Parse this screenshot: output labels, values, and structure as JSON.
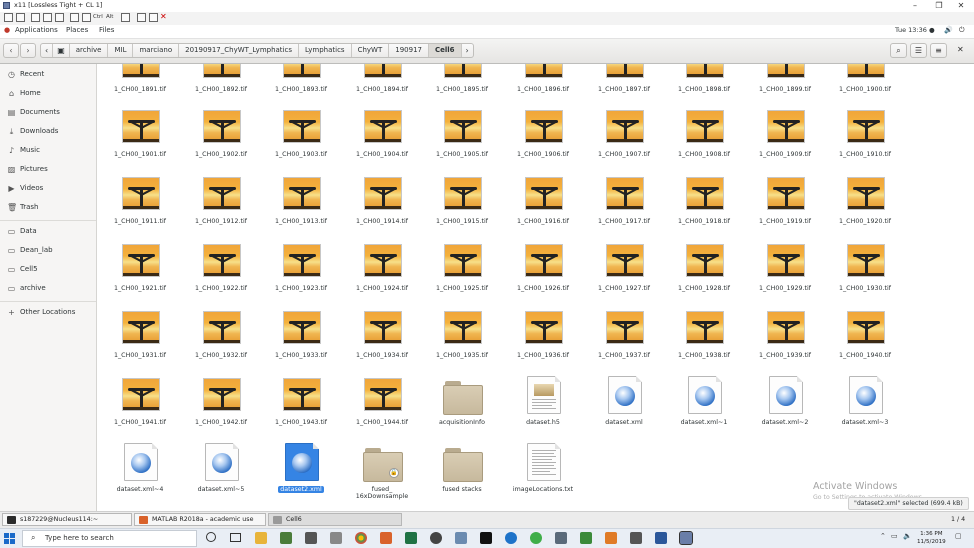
{
  "window": {
    "title": "x11 [Lossless Tight + CL 1]",
    "controls": [
      "–",
      "❐",
      "✕"
    ]
  },
  "vnc_toolbar": {
    "labels": [
      "Ctrl",
      "Alt"
    ]
  },
  "gnome_bar": {
    "applications": "Applications",
    "places": "Places",
    "files": "Files",
    "clock": "Tue 13:36 ●"
  },
  "breadcrumbs": [
    "archive",
    "MIL",
    "marciano",
    "20190917_ChyWT_Lymphatics",
    "Lymphatics",
    "ChyWT",
    "190917",
    "Cell6"
  ],
  "sidebar": {
    "items": [
      {
        "label": "Recent",
        "icon": "clock-icon"
      },
      {
        "label": "Home",
        "icon": "home-icon"
      },
      {
        "label": "Documents",
        "icon": "documents-icon"
      },
      {
        "label": "Downloads",
        "icon": "downloads-icon"
      },
      {
        "label": "Music",
        "icon": "music-icon"
      },
      {
        "label": "Pictures",
        "icon": "pictures-icon"
      },
      {
        "label": "Videos",
        "icon": "videos-icon"
      },
      {
        "label": "Trash",
        "icon": "trash-icon"
      }
    ],
    "bookmarks": [
      {
        "label": "Data",
        "icon": "drive-icon"
      },
      {
        "label": "Dean_lab",
        "icon": "folder-icon"
      },
      {
        "label": "Cell5",
        "icon": "folder-icon"
      },
      {
        "label": "archive",
        "icon": "folder-icon"
      }
    ],
    "other_locations": "Other Locations"
  },
  "files": {
    "row0": [
      "1_CH00_1891.tif",
      "1_CH00_1892.tif",
      "1_CH00_1893.tif",
      "1_CH00_1894.tif",
      "1_CH00_1895.tif",
      "1_CH00_1896.tif",
      "1_CH00_1897.tif",
      "1_CH00_1898.tif",
      "1_CH00_1899.tif",
      "1_CH00_1900.tif"
    ],
    "row1": [
      "1_CH00_1901.tif",
      "1_CH00_1902.tif",
      "1_CH00_1903.tif",
      "1_CH00_1904.tif",
      "1_CH00_1905.tif",
      "1_CH00_1906.tif",
      "1_CH00_1907.tif",
      "1_CH00_1908.tif",
      "1_CH00_1909.tif",
      "1_CH00_1910.tif"
    ],
    "row2": [
      "1_CH00_1911.tif",
      "1_CH00_1912.tif",
      "1_CH00_1913.tif",
      "1_CH00_1914.tif",
      "1_CH00_1915.tif",
      "1_CH00_1916.tif",
      "1_CH00_1917.tif",
      "1_CH00_1918.tif",
      "1_CH00_1919.tif",
      "1_CH00_1920.tif"
    ],
    "row3": [
      "1_CH00_1921.tif",
      "1_CH00_1922.tif",
      "1_CH00_1923.tif",
      "1_CH00_1924.tif",
      "1_CH00_1925.tif",
      "1_CH00_1926.tif",
      "1_CH00_1927.tif",
      "1_CH00_1928.tif",
      "1_CH00_1929.tif",
      "1_CH00_1930.tif"
    ],
    "row4": [
      "1_CH00_1931.tif",
      "1_CH00_1932.tif",
      "1_CH00_1933.tif",
      "1_CH00_1934.tif",
      "1_CH00_1935.tif",
      "1_CH00_1936.tif",
      "1_CH00_1937.tif",
      "1_CH00_1938.tif",
      "1_CH00_1939.tif",
      "1_CH00_1940.tif"
    ],
    "row5": [
      {
        "name": "1_CH00_1941.tif",
        "kind": "tif"
      },
      {
        "name": "1_CH00_1942.tif",
        "kind": "tif"
      },
      {
        "name": "1_CH00_1943.tif",
        "kind": "tif"
      },
      {
        "name": "1_CH00_1944.tif",
        "kind": "tif"
      },
      {
        "name": "acquisitionInfo",
        "kind": "folder"
      },
      {
        "name": "dataset.h5",
        "kind": "doc-image"
      },
      {
        "name": "dataset.xml",
        "kind": "xml"
      },
      {
        "name": "dataset.xml~1",
        "kind": "xml"
      },
      {
        "name": "dataset.xml~2",
        "kind": "xml"
      },
      {
        "name": "dataset.xml~3",
        "kind": "xml"
      }
    ],
    "row6": [
      {
        "name": "dataset.xml~4",
        "kind": "xml"
      },
      {
        "name": "dataset.xml~5",
        "kind": "xml"
      },
      {
        "name": "dataset2.xml",
        "kind": "xml",
        "selected": true
      },
      {
        "name": "fused_\n16xDownsample",
        "kind": "folder-locked"
      },
      {
        "name": "fused stacks",
        "kind": "folder"
      },
      {
        "name": "imageLocations.txt",
        "kind": "txt"
      }
    ]
  },
  "watermark": {
    "title": "Activate Windows",
    "subtitle": "Go to Settings to activate Windows."
  },
  "status": "\"dataset2.xml\" selected (699.4 kB)",
  "window_list": [
    {
      "label": "s187229@Nucleus114:~",
      "color": "#2b2b2b"
    },
    {
      "label": "MATLAB R2018a - academic use",
      "color": "#d9622b"
    },
    {
      "label": "Cell6",
      "color": "#9a9a9a"
    }
  ],
  "pager": "1 / 4",
  "taskbar": {
    "search_placeholder": "Type here to search",
    "time": "1:36 PM",
    "date": "11/5/2019"
  },
  "colors": {
    "selection": "#3584e4",
    "sidebar_bg": "#f6f5f4"
  }
}
